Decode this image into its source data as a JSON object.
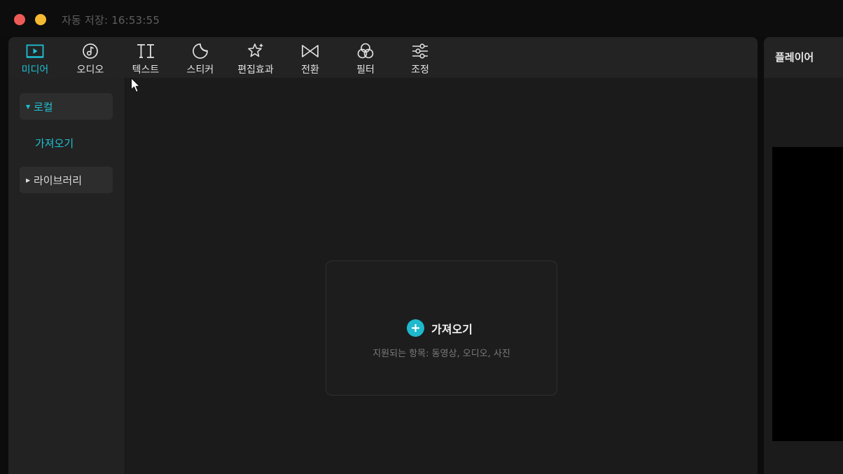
{
  "window": {
    "autosave_text": "자동 저장: 16:53:55"
  },
  "toolbar": {
    "items": [
      {
        "label": "미디어",
        "icon": "media-play-icon",
        "active": true
      },
      {
        "label": "오디오",
        "icon": "audio-note-icon",
        "active": false
      },
      {
        "label": "텍스트",
        "icon": "text-ti-icon",
        "active": false
      },
      {
        "label": "스티커",
        "icon": "sticker-icon",
        "active": false
      },
      {
        "label": "편집효과",
        "icon": "effects-star-icon",
        "active": false
      },
      {
        "label": "전환",
        "icon": "transition-bowtie-icon",
        "active": false
      },
      {
        "label": "필터",
        "icon": "filter-circles-icon",
        "active": false
      },
      {
        "label": "조정",
        "icon": "adjust-sliders-icon",
        "active": false
      }
    ]
  },
  "sidebar": {
    "local_label": "로컬",
    "import_label": "가져오기",
    "library_label": "라이브러리"
  },
  "import_card": {
    "title": "가져오기",
    "subtitle": "지원되는 항목: 동영상, 오디오, 사진"
  },
  "player": {
    "title": "플레이어"
  },
  "colors": {
    "accent": "#1fc1d4",
    "background": "#1b1b1b",
    "toolbar": "#232323"
  }
}
